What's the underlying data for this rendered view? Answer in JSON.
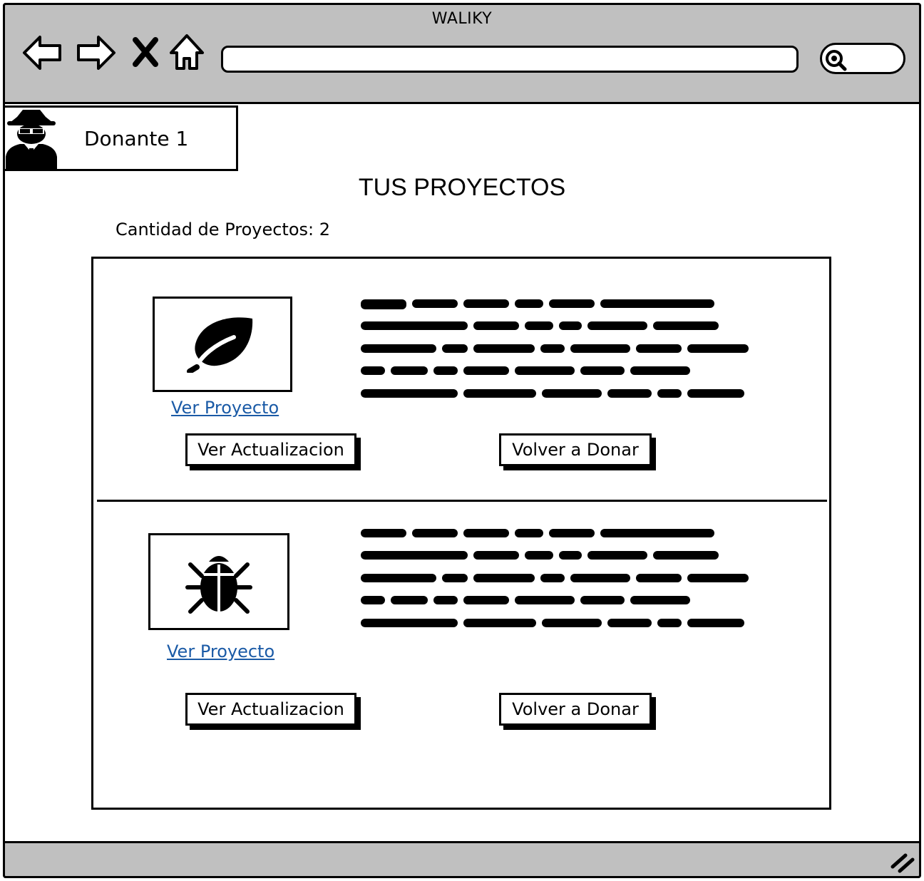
{
  "browser": {
    "title": "WALIKY",
    "url": "",
    "search": ""
  },
  "user": {
    "name": "Donante 1",
    "avatar_icon": "spy-avatar-icon"
  },
  "page": {
    "title": "TUS PROYECTOS",
    "count_label": "Cantidad de Proyectos: 2"
  },
  "projects": [
    {
      "icon": "leaf-icon",
      "link_label": "Ver Proyecto",
      "updates_button": "Ver Actualizacion",
      "donate_button": "Volver a Donar"
    },
    {
      "icon": "bug-icon",
      "link_label": "Ver Proyecto",
      "updates_button": "Ver Actualizacion",
      "donate_button": "Volver a Donar"
    }
  ],
  "colors": {
    "chrome": "#c0c0c0",
    "link": "#1a5aa6"
  }
}
